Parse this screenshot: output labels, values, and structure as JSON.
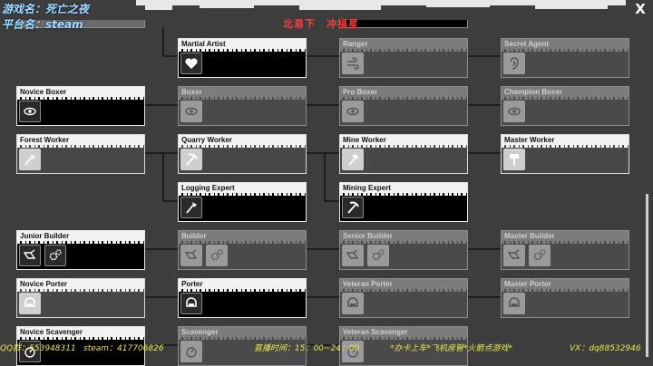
{
  "overlay": {
    "game_title": "游戏名：死亡之夜",
    "platform": "平台名：steam",
    "red_banner": "北易下　冲福星",
    "ticker": {
      "qq": "QQ群：553948311",
      "steam": "steam：417706826",
      "time": "直播时间：15：00~24：00",
      "slogan": "*办卡上车*飞机房管*火箭点游戏*",
      "vx": "VX：dq88532946"
    }
  },
  "close_label": "X",
  "nodes": [
    {
      "id": "martial-artist",
      "title": "Martial Artist",
      "state": "active",
      "icons": [
        "heart-icon"
      ]
    },
    {
      "id": "ranger",
      "title": "Ranger",
      "state": "locked",
      "icons": [
        "wind-icon"
      ]
    },
    {
      "id": "secret-agent",
      "title": "Secret Agent",
      "state": "locked",
      "icons": [
        "ear-icon"
      ]
    },
    {
      "id": "novice-boxer",
      "title": "Novice Boxer",
      "state": "active",
      "icons": [
        "eye-icon"
      ]
    },
    {
      "id": "boxer",
      "title": "Boxer",
      "state": "locked",
      "icons": [
        "eye-icon"
      ]
    },
    {
      "id": "pro-boxer",
      "title": "Pro Boxer",
      "state": "locked",
      "icons": [
        "eye-icon"
      ]
    },
    {
      "id": "champion-boxer",
      "title": "Champion Boxer",
      "state": "locked",
      "icons": [
        "eye-icon"
      ]
    },
    {
      "id": "forest-worker",
      "title": "Forest Worker",
      "state": "worker",
      "icons": [
        "axe-icon"
      ]
    },
    {
      "id": "quarry-worker",
      "title": "Quarry Worker",
      "state": "worker",
      "icons": [
        "pickaxe-icon"
      ]
    },
    {
      "id": "mine-worker",
      "title": "Mine Worker",
      "state": "worker",
      "icons": [
        "hammer-icon"
      ]
    },
    {
      "id": "master-worker",
      "title": "Master Worker",
      "state": "worker",
      "icons": [
        "sledgehammer-icon"
      ]
    },
    {
      "id": "logging-expert",
      "title": "Logging Expert",
      "state": "active",
      "icons": [
        "axe-icon"
      ]
    },
    {
      "id": "mining-expert",
      "title": "Mining Expert",
      "state": "active",
      "icons": [
        "pickaxe-icon"
      ]
    },
    {
      "id": "junior-builder",
      "title": "Junior Builder",
      "state": "active",
      "icons": [
        "trowel-icon",
        "gears-icon"
      ]
    },
    {
      "id": "builder",
      "title": "Builder",
      "state": "locked",
      "icons": [
        "trowel-icon",
        "gears-icon"
      ]
    },
    {
      "id": "senior-builder",
      "title": "Senior Builder",
      "state": "locked",
      "icons": [
        "trowel-icon",
        "gears-icon"
      ]
    },
    {
      "id": "master-builder",
      "title": "Master Builder",
      "state": "locked",
      "icons": [
        "trowel-icon",
        "gears-icon"
      ]
    },
    {
      "id": "novice-porter",
      "title": "Novice Porter",
      "state": "worker",
      "icons": [
        "helmet-icon"
      ]
    },
    {
      "id": "porter",
      "title": "Porter",
      "state": "active",
      "icons": [
        "helmet-icon"
      ]
    },
    {
      "id": "veteran-porter",
      "title": "Veteran Porter",
      "state": "locked",
      "icons": [
        "helmet-icon"
      ]
    },
    {
      "id": "master-porter",
      "title": "Master Porter",
      "state": "locked",
      "icons": [
        "helmet-icon"
      ]
    },
    {
      "id": "novice-scavenger",
      "title": "Novice Scavenger",
      "state": "active",
      "icons": [
        "compass-icon"
      ]
    },
    {
      "id": "scavenger",
      "title": "Scavenger",
      "state": "locked",
      "icons": [
        "compass-icon"
      ]
    },
    {
      "id": "veteran-scavenger",
      "title": "Veteran Scavenger",
      "state": "locked",
      "icons": [
        "compass-icon"
      ]
    }
  ]
}
